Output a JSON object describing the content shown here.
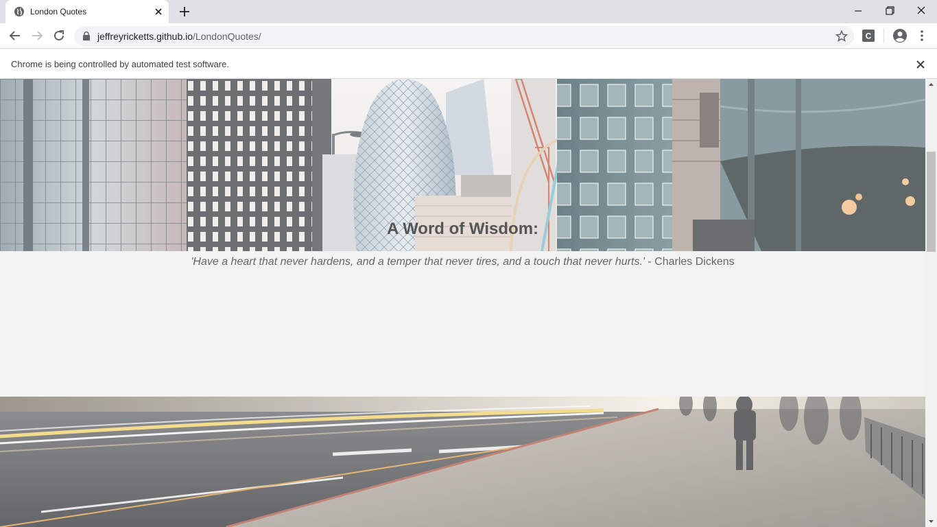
{
  "browser": {
    "tab": {
      "title": "London Quotes"
    },
    "url": {
      "host": "jeffreyricketts.github.io",
      "path": "/LondonQuotes/"
    },
    "infobar": {
      "text": "Chrome is being controlled by automated test software."
    },
    "extension_letter": "C"
  },
  "page": {
    "heading": "A Word of Wisdom:",
    "quote": "'Have a heart that never hardens, and a temper that never tires, and a touch that never hurts.'",
    "attribution": " - Charles Dickens"
  },
  "icons": {
    "favicon": "globe-icon",
    "tab_close": "close-icon",
    "new_tab": "plus-icon",
    "back": "arrow-left-icon",
    "forward": "arrow-right-icon",
    "reload": "reload-icon",
    "lock": "lock-icon",
    "bookmark": "star-icon",
    "profile": "account-icon",
    "menu": "kebab-menu-icon"
  }
}
